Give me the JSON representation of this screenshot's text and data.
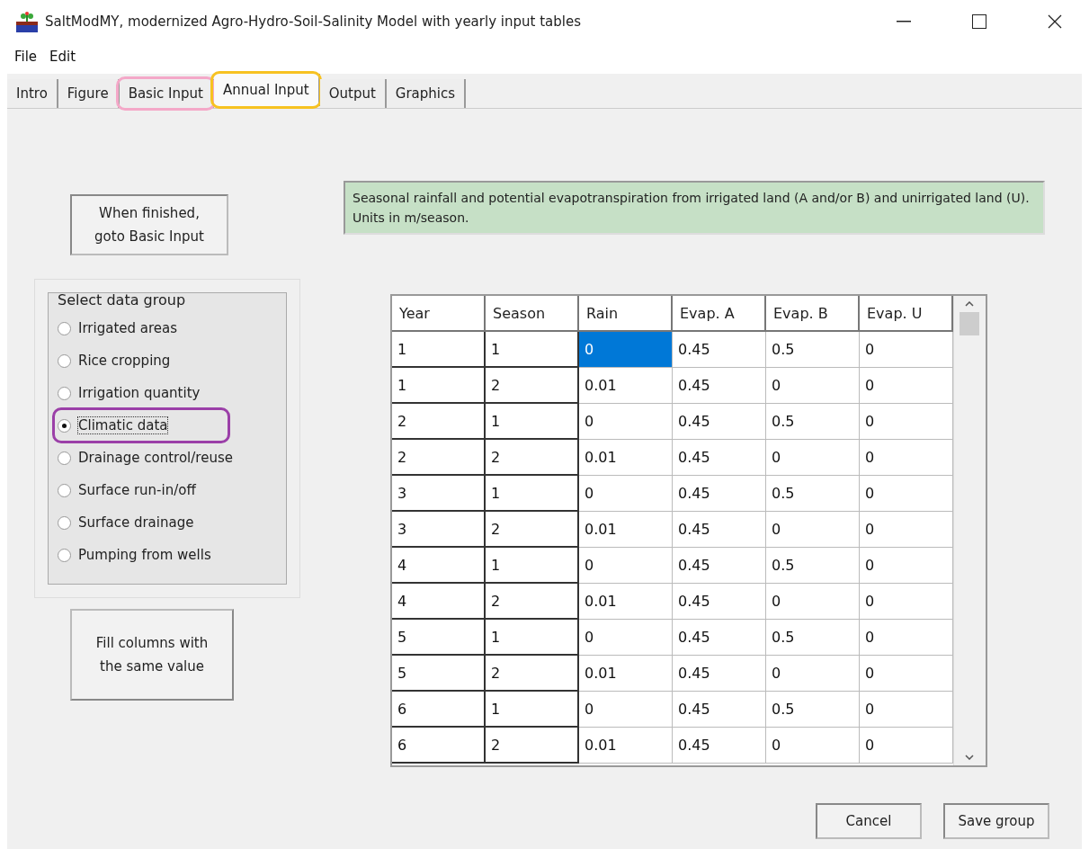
{
  "window": {
    "title": "SaltModMY, modernized Agro-Hydro-Soil-Salinity Model with yearly input tables"
  },
  "menu": [
    "File",
    "Edit"
  ],
  "tabs": [
    {
      "label": "Intro",
      "selected": false
    },
    {
      "label": "Figure",
      "selected": false
    },
    {
      "label": "Basic Input",
      "selected": false,
      "color": "#f4a8c8"
    },
    {
      "label": "Annual Input",
      "selected": true,
      "color": "#f7c221"
    },
    {
      "label": "Output",
      "selected": false
    },
    {
      "label": "Graphics",
      "selected": false
    }
  ],
  "finish_button": "When finished,\ngoto Basic Input",
  "data_group": {
    "title": "Select data group",
    "options": [
      {
        "label": "Irrigated areas",
        "selected": false
      },
      {
        "label": "Rice cropping",
        "selected": false
      },
      {
        "label": "Irrigation quantity",
        "selected": false
      },
      {
        "label": "Climatic data",
        "selected": true,
        "color": "#9b3fa8"
      },
      {
        "label": "Drainage control/reuse",
        "selected": false
      },
      {
        "label": "Surface run-in/off",
        "selected": false
      },
      {
        "label": "Surface drainage",
        "selected": false
      },
      {
        "label": "Pumping from wells",
        "selected": false
      }
    ]
  },
  "fill_button": "Fill columns with\nthe same value",
  "note": "Seasonal rainfall and potential evapotranspiration from irrigated land (A and/or B) and unirrigated land (U).  Units in m/season.",
  "table": {
    "columns": [
      "Year",
      "Season",
      "Rain",
      "Evap. A",
      "Evap. B",
      "Evap. U"
    ],
    "rows": [
      {
        "cells": [
          {
            "text": "1",
            "selected": false
          },
          {
            "text": "1",
            "selected": false
          },
          {
            "text": "0",
            "selected": true
          },
          {
            "text": "0.45",
            "selected": false
          },
          {
            "text": "0.5",
            "selected": false
          },
          {
            "text": "0",
            "selected": false
          }
        ]
      },
      {
        "cells": [
          {
            "text": "1",
            "selected": false
          },
          {
            "text": "2",
            "selected": false
          },
          {
            "text": "0.01",
            "selected": false
          },
          {
            "text": "0.45",
            "selected": false
          },
          {
            "text": "0",
            "selected": false
          },
          {
            "text": "0",
            "selected": false
          }
        ]
      },
      {
        "cells": [
          {
            "text": "2",
            "selected": false
          },
          {
            "text": "1",
            "selected": false
          },
          {
            "text": "0",
            "selected": false
          },
          {
            "text": "0.45",
            "selected": false
          },
          {
            "text": "0.5",
            "selected": false
          },
          {
            "text": "0",
            "selected": false
          }
        ]
      },
      {
        "cells": [
          {
            "text": "2",
            "selected": false
          },
          {
            "text": "2",
            "selected": false
          },
          {
            "text": "0.01",
            "selected": false
          },
          {
            "text": "0.45",
            "selected": false
          },
          {
            "text": "0",
            "selected": false
          },
          {
            "text": "0",
            "selected": false
          }
        ]
      },
      {
        "cells": [
          {
            "text": "3",
            "selected": false
          },
          {
            "text": "1",
            "selected": false
          },
          {
            "text": "0",
            "selected": false
          },
          {
            "text": "0.45",
            "selected": false
          },
          {
            "text": "0.5",
            "selected": false
          },
          {
            "text": "0",
            "selected": false
          }
        ]
      },
      {
        "cells": [
          {
            "text": "3",
            "selected": false
          },
          {
            "text": "2",
            "selected": false
          },
          {
            "text": "0.01",
            "selected": false
          },
          {
            "text": "0.45",
            "selected": false
          },
          {
            "text": "0",
            "selected": false
          },
          {
            "text": "0",
            "selected": false
          }
        ]
      },
      {
        "cells": [
          {
            "text": "4",
            "selected": false
          },
          {
            "text": "1",
            "selected": false
          },
          {
            "text": "0",
            "selected": false
          },
          {
            "text": "0.45",
            "selected": false
          },
          {
            "text": "0.5",
            "selected": false
          },
          {
            "text": "0",
            "selected": false
          }
        ]
      },
      {
        "cells": [
          {
            "text": "4",
            "selected": false
          },
          {
            "text": "2",
            "selected": false
          },
          {
            "text": "0.01",
            "selected": false
          },
          {
            "text": "0.45",
            "selected": false
          },
          {
            "text": "0",
            "selected": false
          },
          {
            "text": "0",
            "selected": false
          }
        ]
      },
      {
        "cells": [
          {
            "text": "5",
            "selected": false
          },
          {
            "text": "1",
            "selected": false
          },
          {
            "text": "0",
            "selected": false
          },
          {
            "text": "0.45",
            "selected": false
          },
          {
            "text": "0.5",
            "selected": false
          },
          {
            "text": "0",
            "selected": false
          }
        ]
      },
      {
        "cells": [
          {
            "text": "5",
            "selected": false
          },
          {
            "text": "2",
            "selected": false
          },
          {
            "text": "0.01",
            "selected": false
          },
          {
            "text": "0.45",
            "selected": false
          },
          {
            "text": "0",
            "selected": false
          },
          {
            "text": "0",
            "selected": false
          }
        ]
      },
      {
        "cells": [
          {
            "text": "6",
            "selected": false
          },
          {
            "text": "1",
            "selected": false
          },
          {
            "text": "0",
            "selected": false
          },
          {
            "text": "0.45",
            "selected": false
          },
          {
            "text": "0.5",
            "selected": false
          },
          {
            "text": "0",
            "selected": false
          }
        ]
      },
      {
        "cells": [
          {
            "text": "6",
            "selected": false
          },
          {
            "text": "2",
            "selected": false
          },
          {
            "text": "0.01",
            "selected": false
          },
          {
            "text": "0.45",
            "selected": false
          },
          {
            "text": "0",
            "selected": false
          },
          {
            "text": "0",
            "selected": false
          }
        ]
      }
    ]
  },
  "buttons": [
    "Cancel",
    "Save group"
  ]
}
